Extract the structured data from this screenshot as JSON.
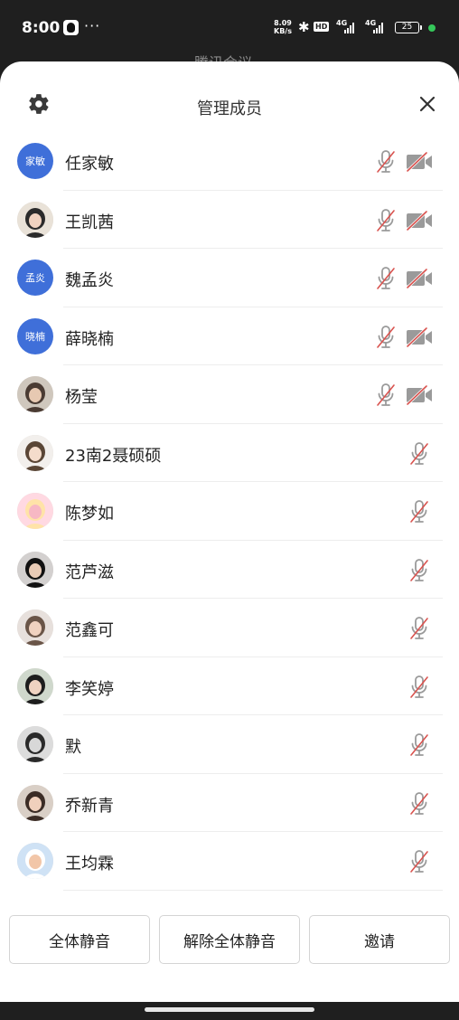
{
  "status_bar": {
    "time": "8:00",
    "dots": "···",
    "net_speed_value": "8.09",
    "net_speed_unit": "KB/s",
    "bluetooth_icon": "bluetooth-icon",
    "hd_label": "HD",
    "signal1_label": "4G",
    "signal2_label": "4G",
    "battery_level": "25",
    "charge_color": "#35c75a"
  },
  "behind_title": "腾讯会议",
  "sheet": {
    "title": "管理成员",
    "settings_icon": "gear-icon",
    "close_icon": "close-icon"
  },
  "members": [
    {
      "name": "任家敏",
      "avatar_type": "text",
      "avatar_text": "家敏",
      "has_camera": true
    },
    {
      "name": "王凯茜",
      "avatar_type": "photo",
      "avatar_text": "",
      "has_camera": true
    },
    {
      "name": "魏孟炎",
      "avatar_type": "text",
      "avatar_text": "孟炎",
      "has_camera": true
    },
    {
      "name": "薛晓楠",
      "avatar_type": "text",
      "avatar_text": "晓楠",
      "has_camera": true
    },
    {
      "name": "杨莹",
      "avatar_type": "photo",
      "avatar_text": "",
      "has_camera": true
    },
    {
      "name": "23南2聂硕硕",
      "avatar_type": "photo",
      "avatar_text": "",
      "has_camera": false
    },
    {
      "name": "陈梦如",
      "avatar_type": "photo",
      "avatar_text": "",
      "has_camera": false
    },
    {
      "name": "范芦滋",
      "avatar_type": "photo",
      "avatar_text": "",
      "has_camera": false
    },
    {
      "name": "范鑫可",
      "avatar_type": "photo",
      "avatar_text": "",
      "has_camera": false
    },
    {
      "name": "李笑婷",
      "avatar_type": "photo",
      "avatar_text": "",
      "has_camera": false
    },
    {
      "name": "默",
      "avatar_type": "photo",
      "avatar_text": "",
      "has_camera": false
    },
    {
      "name": "乔新青",
      "avatar_type": "photo",
      "avatar_text": "",
      "has_camera": false
    },
    {
      "name": "王均霖",
      "avatar_type": "photo",
      "avatar_text": "",
      "has_camera": false
    }
  ],
  "icons": {
    "mic": "mic-muted-icon",
    "camera": "camera-off-icon",
    "muted_color": "#d9534f",
    "icon_gray": "#9a9a9a"
  },
  "buttons": {
    "mute_all": "全体静音",
    "unmute_all": "解除全体静音",
    "invite": "邀请"
  },
  "colors": {
    "avatar_blue": "#3f6fd9",
    "background_dark": "#1f1f1f",
    "sheet_bg": "#ffffff"
  }
}
